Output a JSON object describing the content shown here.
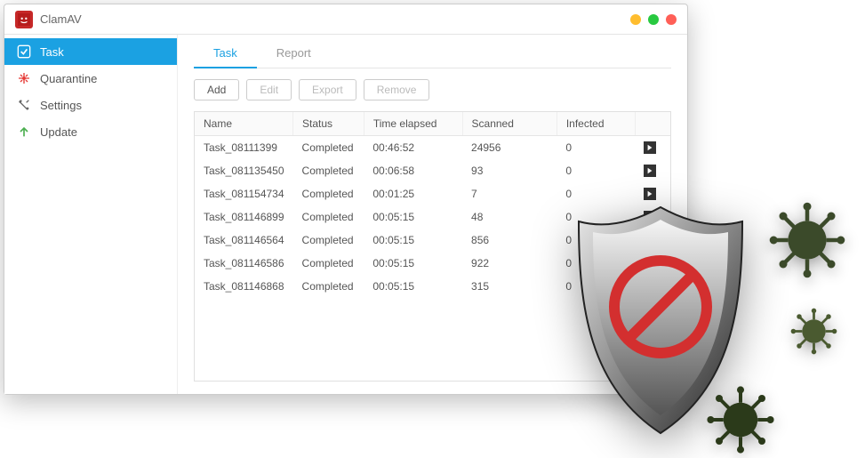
{
  "app": {
    "title": "ClamAV"
  },
  "sidebar": {
    "items": [
      {
        "label": "Task",
        "icon": "check"
      },
      {
        "label": "Quarantine",
        "icon": "quarantine"
      },
      {
        "label": "Settings",
        "icon": "settings"
      },
      {
        "label": "Update",
        "icon": "update"
      }
    ]
  },
  "tabs": [
    {
      "label": "Task"
    },
    {
      "label": "Report"
    }
  ],
  "toolbar": {
    "add": "Add",
    "edit": "Edit",
    "export": "Export",
    "remove": "Remove"
  },
  "columns": {
    "name": "Name",
    "status": "Status",
    "time": "Time elapsed",
    "scanned": "Scanned",
    "infected": "Infected"
  },
  "rows": [
    {
      "name": "Task_08111399",
      "status": "Completed",
      "time": "00:46:52",
      "scanned": "24956",
      "infected": "0",
      "play": true
    },
    {
      "name": "Task_081135450",
      "status": "Completed",
      "time": "00:06:58",
      "scanned": "93",
      "infected": "0",
      "play": true
    },
    {
      "name": "Task_081154734",
      "status": "Completed",
      "time": "00:01:25",
      "scanned": "7",
      "infected": "0",
      "play": true
    },
    {
      "name": "Task_081146899",
      "status": "Completed",
      "time": "00:05:15",
      "scanned": "48",
      "infected": "0",
      "play": true
    },
    {
      "name": "Task_081146564",
      "status": "Completed",
      "time": "00:05:15",
      "scanned": "856",
      "infected": "0",
      "play": true
    },
    {
      "name": "Task_081146586",
      "status": "Completed",
      "time": "00:05:15",
      "scanned": "922",
      "infected": "0",
      "play": false
    },
    {
      "name": "Task_081146868",
      "status": "Completed",
      "time": "00:05:15",
      "scanned": "315",
      "infected": "0",
      "play": false
    }
  ]
}
